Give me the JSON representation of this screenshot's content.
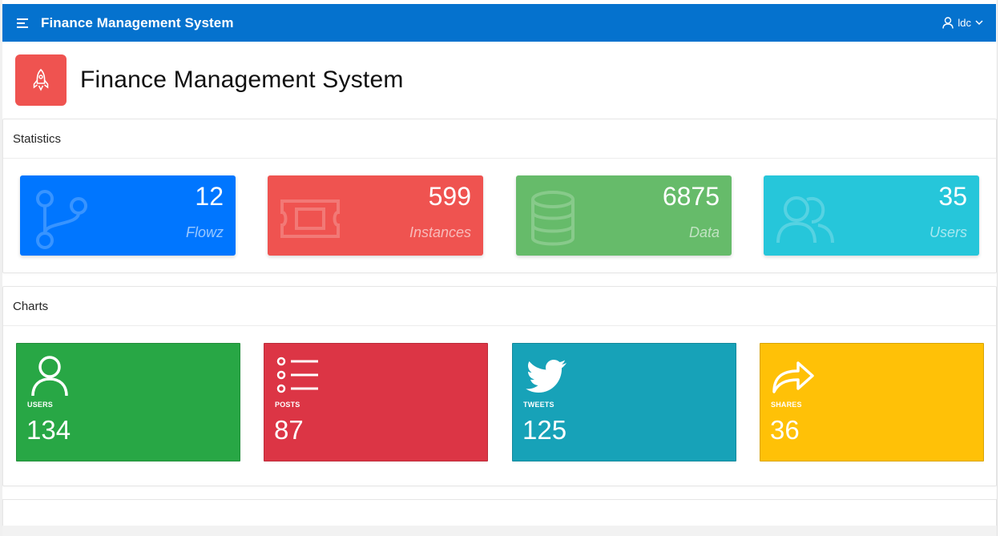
{
  "header": {
    "app_title": "Finance Management System",
    "user_name": "ldc"
  },
  "hero": {
    "title": "Finance Management System",
    "icon": "rocket-icon",
    "icon_color": "#ef5350"
  },
  "colors": {
    "header_bg": "#0572ce"
  },
  "statistics": {
    "title": "Statistics",
    "cards": [
      {
        "value": "12",
        "label": "Flowz",
        "icon": "branch-icon",
        "color": "#0076ff"
      },
      {
        "value": "599",
        "label": "Instances",
        "icon": "ticket-icon",
        "color": "#ef5350"
      },
      {
        "value": "6875",
        "label": "Data",
        "icon": "database-icon",
        "color": "#66bb6a"
      },
      {
        "value": "35",
        "label": "Users",
        "icon": "users-icon",
        "color": "#26c6da"
      }
    ]
  },
  "charts": {
    "title": "Charts",
    "cards": [
      {
        "label": "USERS",
        "value": "134",
        "icon": "user-icon",
        "color": "#28a745"
      },
      {
        "label": "POSTS",
        "value": "87",
        "icon": "list-icon",
        "color": "#dc3545"
      },
      {
        "label": "TWEETS",
        "value": "125",
        "icon": "twitter-icon",
        "color": "#17a2b8"
      },
      {
        "label": "SHARES",
        "value": "36",
        "icon": "share-icon",
        "color": "#ffc107"
      }
    ]
  }
}
